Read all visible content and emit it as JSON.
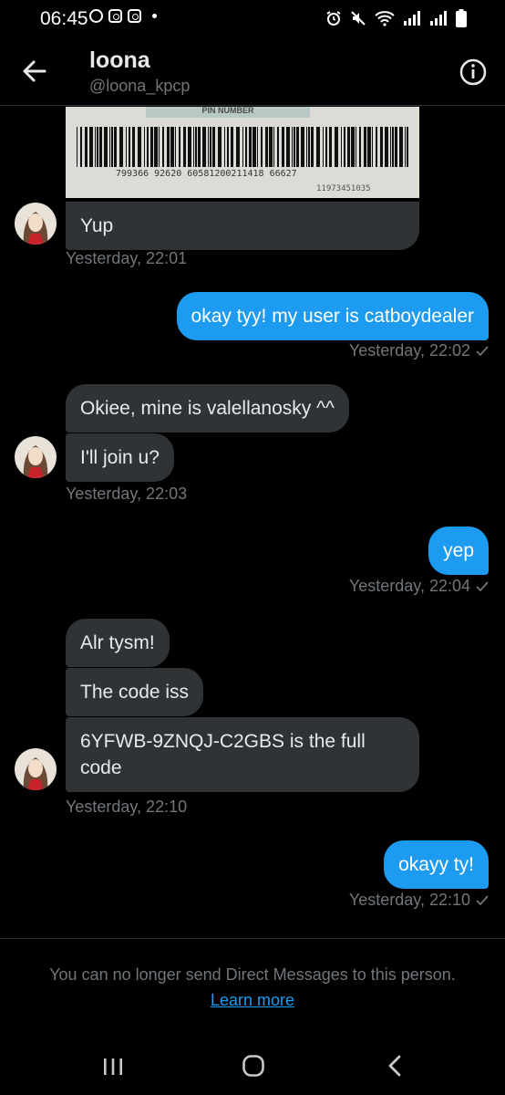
{
  "status_bar": {
    "time": "06:45",
    "left_icons": [
      "whatsapp-icon",
      "instagram-icon",
      "instagram-icon",
      "notification-dot"
    ],
    "right_icons": [
      "alarm-icon",
      "mute-icon",
      "wifi-icon",
      "signal-icon",
      "signal-icon",
      "battery-icon"
    ]
  },
  "header": {
    "name": "loona",
    "handle": "@loona_kpcp",
    "back_icon": "arrow-left-icon",
    "info_icon": "info-icon"
  },
  "image_message": {
    "barcode_text": "799366 92620 60581200211418 66627",
    "barcode_text_2": "11973451035",
    "pin_label": "PIN NUMBER"
  },
  "messages": [
    {
      "id": "m1",
      "side": "received",
      "text": "Yup"
    },
    {
      "id": "t1",
      "timestamp": "Yesterday, 22:01"
    },
    {
      "id": "m2",
      "side": "sent",
      "text": "okay tyy! my user is catboydealer"
    },
    {
      "id": "t2",
      "timestamp": "Yesterday, 22:02"
    },
    {
      "id": "m3",
      "side": "received",
      "text": "Okiee, mine is valellanosky ^^"
    },
    {
      "id": "m4",
      "side": "received",
      "text": "I'll join u?"
    },
    {
      "id": "t3",
      "timestamp": "Yesterday, 22:03"
    },
    {
      "id": "m5",
      "side": "sent",
      "text": "yep"
    },
    {
      "id": "t4",
      "timestamp": "Yesterday, 22:04"
    },
    {
      "id": "m6",
      "side": "received",
      "text": "Alr tysm!"
    },
    {
      "id": "m7",
      "side": "received",
      "text": "The code iss"
    },
    {
      "id": "m8",
      "side": "received",
      "text_line1": "6YFWB-9ZNQJ-C2GBS is the full",
      "text_line2": "code"
    },
    {
      "id": "t5",
      "timestamp": "Yesterday, 22:10"
    },
    {
      "id": "m9",
      "side": "sent",
      "text": "okayy ty!"
    },
    {
      "id": "t6",
      "timestamp": "Yesterday, 22:10"
    }
  ],
  "footer": {
    "notice": "You can no longer send Direct Messages to this person.",
    "learn_more": "Learn more"
  },
  "nav_bar": [
    "recents-icon",
    "home-icon",
    "back-icon"
  ],
  "colors": {
    "background": "#000000",
    "sent_bubble": "#1d9bf0",
    "received_bubble": "#2f3336",
    "secondary_text": "#71767b",
    "link": "#1d9bf0"
  }
}
